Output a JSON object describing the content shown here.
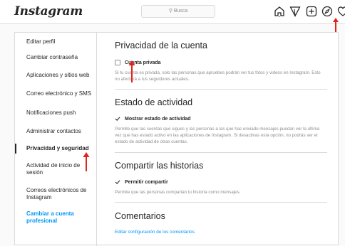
{
  "header": {
    "logo": "Instagram",
    "search_placeholder": "Busca",
    "icons": [
      "home-icon",
      "direct-icon",
      "new-post-icon",
      "explore-icon",
      "activity-icon",
      "avatar-icon"
    ]
  },
  "sidebar": {
    "items": [
      {
        "label": "Editar perfil"
      },
      {
        "label": "Cambiar contraseña"
      },
      {
        "label": "Aplicaciones y sitios web"
      },
      {
        "label": "Correo electrónico y SMS"
      },
      {
        "label": "Notificaciones push"
      },
      {
        "label": "Administrar contactos"
      },
      {
        "label": "Privacidad y seguridad"
      },
      {
        "label": "Actividad de inicio de sesión"
      },
      {
        "label": "Correos electrónicos de Instagram"
      },
      {
        "label": "Cambiar a cuenta profesional"
      }
    ]
  },
  "main": {
    "privacy": {
      "title": "Privacidad de la cuenta",
      "checkbox_label": "Cuenta privada",
      "description": "Si tu cuenta es privada, solo las personas que apruebes podrán ver tus fotos y videos en Instagram. Esto no afectará a tus seguidores actuales."
    },
    "activity": {
      "title": "Estado de actividad",
      "checkbox_label": "Mostrar estado de actividad",
      "description": "Permite que las cuentas que sigues y las personas a las que has enviado mensajes puedan ver la última vez que has estado activo en las aplicaciones de Instagram. Si desactivas esta opción, no podrás ver el estado de actividad de otras cuentas."
    },
    "stories": {
      "title": "Compartir las historias",
      "checkbox_label": "Permitir compartir",
      "description": "Permite que las personas compartan tu historia como mensajes."
    },
    "comments": {
      "title": "Comentarios",
      "link": "Editar configuración de los comentarios"
    }
  },
  "colors": {
    "accent": "#0095f6",
    "annotation_arrow": "#e0241b",
    "text": "#262626",
    "muted": "#8e8e8e",
    "border": "#dbdbdb"
  }
}
